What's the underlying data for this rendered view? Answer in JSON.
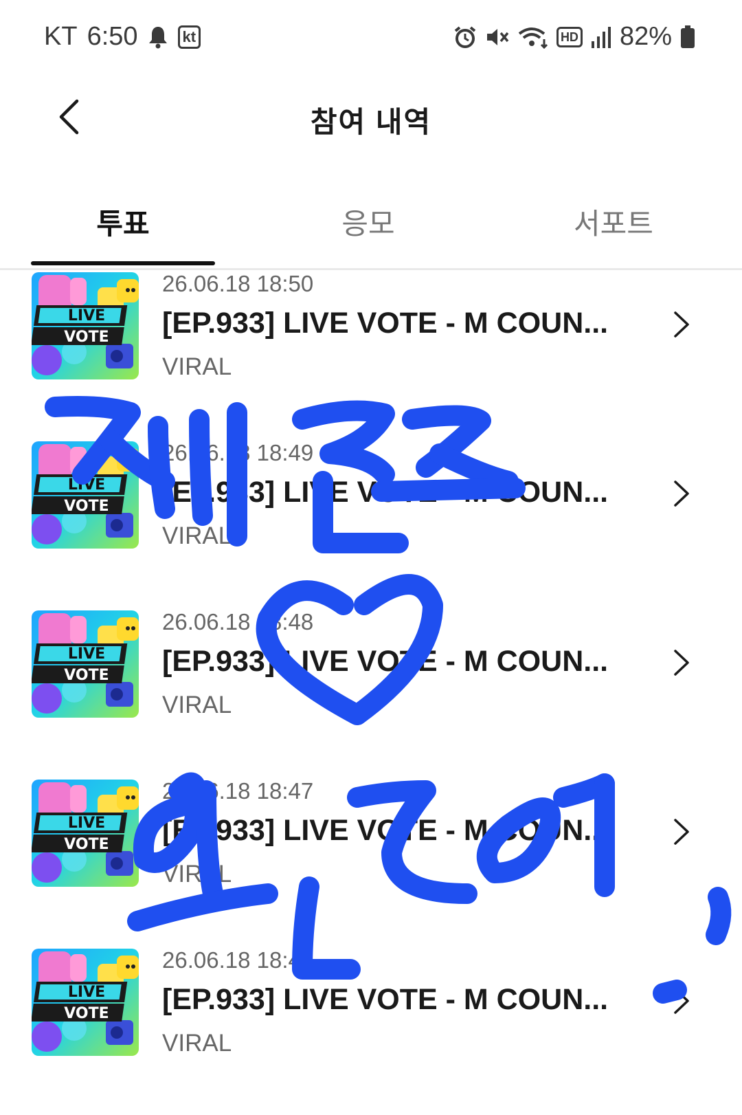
{
  "status_bar": {
    "carrier": "KT",
    "time": "6:50",
    "kt_badge": "kt",
    "hd_badge": "HD",
    "battery": "82%"
  },
  "header": {
    "title": "참여 내역"
  },
  "tabs": [
    {
      "label": "투표",
      "active": true
    },
    {
      "label": "응모",
      "active": false
    },
    {
      "label": "서포트",
      "active": false
    }
  ],
  "thumbnail": {
    "line1": "LIVE",
    "line2": "VOTE"
  },
  "items": [
    {
      "date": "26.06.18 18:50",
      "title": "[EP.933] LIVE VOTE - M COUN...",
      "category": "VIRAL"
    },
    {
      "date": "26.06.18 18:49",
      "title": "[EP.933] LIVE VOTE - M COUN...",
      "category": "VIRAL"
    },
    {
      "date": "26.06.18 18:48",
      "title": "[EP.933] LIVE VOTE - M COUN...",
      "category": "VIRAL"
    },
    {
      "date": "26.06.18 18:47",
      "title": "[EP.933] LIVE VOTE - M COUN...",
      "category": "VIRAL"
    },
    {
      "date": "26.06.18 18:46",
      "title": "[EP.933] LIVE VOTE - M COUN...",
      "category": "VIRAL"
    }
  ],
  "colors": {
    "scribble": "#1f4ff0",
    "tab_underline": "#111111"
  }
}
